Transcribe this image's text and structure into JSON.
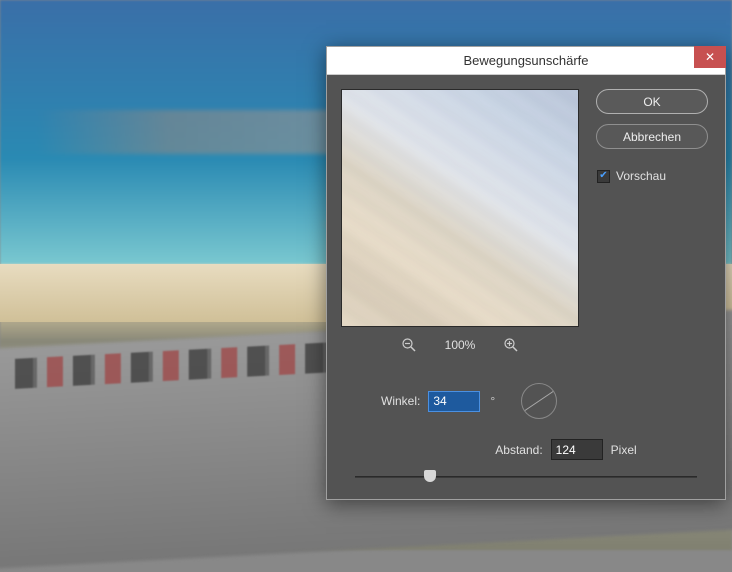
{
  "dialog": {
    "title": "Bewegungsunschärfe",
    "ok_label": "OK",
    "cancel_label": "Abbrechen",
    "preview_checkbox_label": "Vorschau",
    "preview_checked": true,
    "zoom_level": "100%",
    "angle_label": "Winkel:",
    "angle_value": "34",
    "angle_unit": "°",
    "distance_label": "Abstand:",
    "distance_value": "124",
    "distance_unit": "Pixel"
  },
  "icons": {
    "close": "✕",
    "check": "✔"
  }
}
